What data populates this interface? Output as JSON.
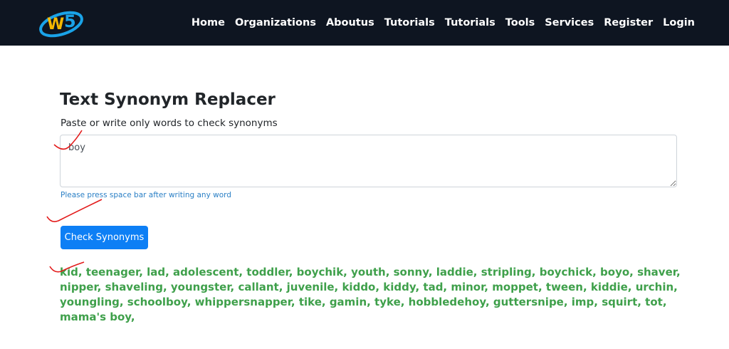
{
  "nav": {
    "items": [
      "Home",
      "Organizations",
      "Aboutus",
      "Tutorials",
      "Tutorials",
      "Tools",
      "Services",
      "Register",
      "Login"
    ]
  },
  "colors": {
    "navbar": "#0e1521",
    "button": "#0d7ff5",
    "results": "#3fa04b",
    "hint": "#2a7fc5",
    "annotation": "#e31b1b"
  },
  "main": {
    "title": "Text Synonym Replacer",
    "subtitle": "Paste or write only words to check synonyms",
    "input_value": "boy",
    "hint": "Please press space bar after writing any word",
    "button_label": "Check Synonyms",
    "results": "kid, teenager, lad, adolescent, toddler, boychik, youth, sonny, laddie, stripling, boychick, boyo, shaver, nipper, shaveling, youngster, callant, juvenile, kiddo, kiddy, tad, minor, moppet, tween, kiddie, urchin, youngling, schoolboy, whippersnapper, tike, gamin, tyke, hobbledehoy, guttersnipe, imp, squirt, tot, mama's boy,"
  }
}
